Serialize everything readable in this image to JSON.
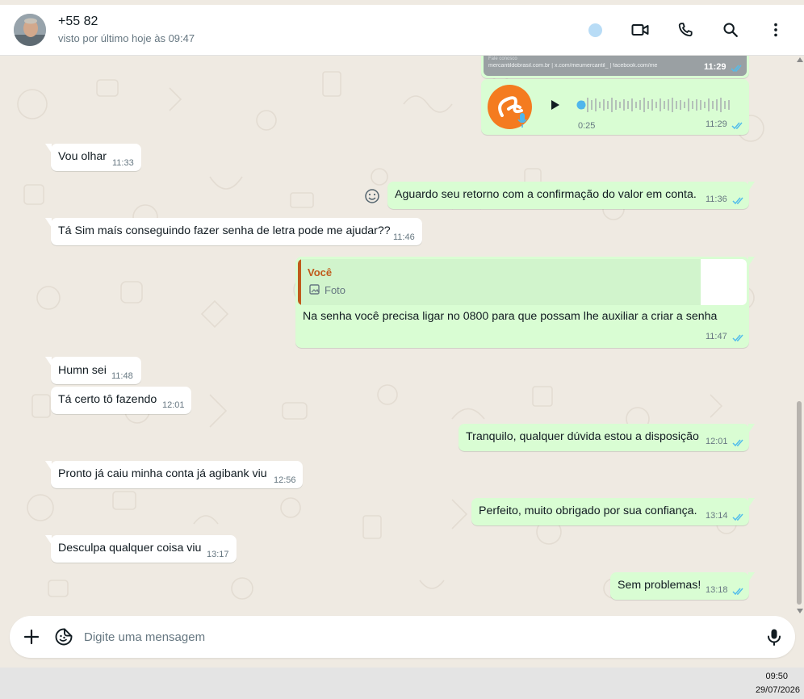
{
  "header": {
    "contact_name": "+55 82",
    "last_seen": "visto por último hoje às 09:47",
    "icons": [
      "video-camera-icon",
      "phone-icon",
      "search-icon",
      "more-vertical-icon"
    ]
  },
  "messages": [
    {
      "dir": "out",
      "kind": "link-preview",
      "text": "mercantildobrasil.com.br | x.com/meumercantil_ | facebook.com/me",
      "caption": "Fale conosco",
      "time": "11:29"
    },
    {
      "dir": "out",
      "kind": "audio",
      "duration": "0:25",
      "time": "11:29"
    },
    {
      "dir": "in",
      "text": "Vou olhar",
      "time": "11:33"
    },
    {
      "dir": "out",
      "text": "Aguardo seu retorno com a confirmação do valor em conta.",
      "time": "11:36"
    },
    {
      "dir": "in",
      "text": "Tá Sim maís conseguindo fazer senha de letra pode me ajudar??",
      "time": "11:46"
    },
    {
      "dir": "out",
      "kind": "reply",
      "quote_author": "Você",
      "quote_text": "Foto",
      "text": "Na senha você precisa ligar no 0800 para que possam lhe auxiliar a criar a senha",
      "time": "11:47"
    },
    {
      "dir": "in",
      "text": "Humn sei",
      "time": "11:48"
    },
    {
      "dir": "in",
      "text": "Tá certo tô fazendo",
      "time": "12:01"
    },
    {
      "dir": "out",
      "text": "Tranquilo, qualquer dúvida estou a disposição",
      "time": "12:01"
    },
    {
      "dir": "in",
      "text": "Pronto já caiu minha conta já agibank viu",
      "time": "12:56"
    },
    {
      "dir": "out",
      "text": "Perfeito, muito obrigado por sua confiança.",
      "time": "13:14"
    },
    {
      "dir": "in",
      "text": "Desculpa qualquer coisa viu",
      "time": "13:17"
    },
    {
      "dir": "out",
      "text": "Sem problemas!",
      "time": "13:18"
    }
  ],
  "composer": {
    "placeholder": "Digite uma mensagem"
  },
  "taskbar": {
    "time": "09:50",
    "date": "29/07/2026"
  },
  "colors": {
    "outgoing_bubble": "#d9fdd3",
    "incoming_bubble": "#ffffff",
    "wallpaper": "#efeae2",
    "read_tick": "#53bdeb",
    "quote_author": "#c05a1c",
    "audio_accent": "#4fb6ec"
  }
}
